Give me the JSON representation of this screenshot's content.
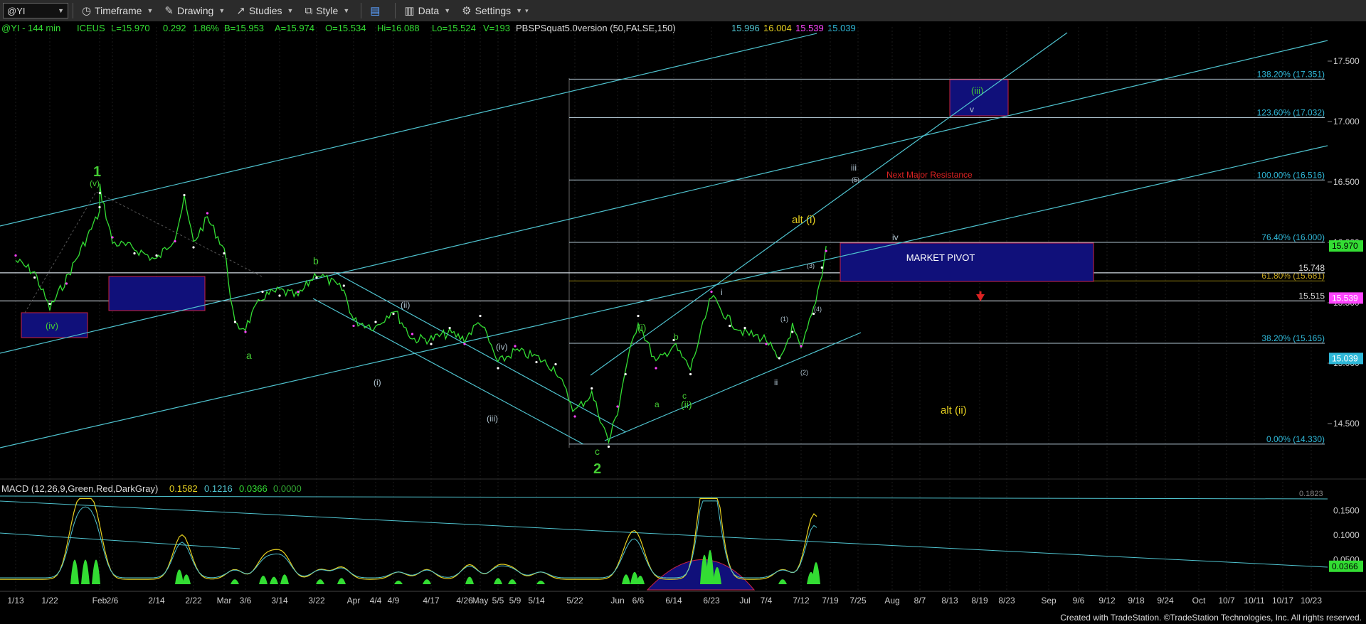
{
  "toolbar": {
    "symbol": "@YI",
    "timeframe": "Timeframe",
    "drawing": "Drawing",
    "studies": "Studies",
    "style": "Style",
    "data": "Data",
    "settings": "Settings"
  },
  "header": {
    "symbol_info": "@YI - 144 min",
    "exchange": "ICEUS",
    "last": "L=15.970",
    "change": "0.292",
    "pct": "1.86%",
    "bid": "B=15.953",
    "ask": "A=15.974",
    "open": "O=15.534",
    "high": "Hi=16.088",
    "low": "Lo=15.524",
    "volume": "V=193",
    "study_name": "PBSPSquat5.0version (50,FALSE,150)",
    "study_values": [
      "15.996",
      "16.004",
      "15.539",
      "15.039"
    ]
  },
  "macd_header": {
    "label": "MACD (12,26,9,Green,Red,DarkGray)",
    "values": [
      "0.1582",
      "0.1216",
      "0.0366",
      "0.0000"
    ]
  },
  "colors": {
    "bg": "#000000",
    "price": "#33dd33",
    "trendline": "#4fc3cf",
    "fib": "#b0c4d0",
    "box": "#10107a",
    "box_border": "#cc2244",
    "wave_green": "#44cc33",
    "wave_yellow": "#e6d020",
    "resistance_red": "#dd2222",
    "magenta": "#ff44ff"
  },
  "chart_data": {
    "type": "line",
    "title": "@YI - 144 min",
    "y_axis_labels": [
      "17.500",
      "17.000",
      "16.500",
      "16.000",
      "15.500",
      "15.000",
      "14.500"
    ],
    "ylim": [
      14.25,
      17.7
    ],
    "x_tick_labels": [
      "1/13",
      "1/22",
      "Feb",
      "2/6",
      "2/14",
      "2/22",
      "Mar",
      "3/6",
      "3/14",
      "3/22",
      "Apr",
      "4/4",
      "4/9",
      "4/17",
      "4/26",
      "May",
      "5/5",
      "5/9",
      "5/14",
      "5/22",
      "Jun",
      "6/6",
      "6/14",
      "6/23",
      "Jul",
      "7/4",
      "7/12",
      "7/19",
      "7/25",
      "Aug",
      "8/7",
      "8/13",
      "8/19",
      "8/23",
      "Sep",
      "9/6",
      "9/12",
      "9/18",
      "9/24",
      "Oct",
      "10/7",
      "10/11",
      "10/17",
      "10/23"
    ],
    "price_series": {
      "name": "@YI",
      "points": [
        [
          "1/13",
          15.85
        ],
        [
          "1/18",
          15.75
        ],
        [
          "1/22",
          15.45
        ],
        [
          "1/26",
          15.7
        ],
        [
          "Feb",
          16.25
        ],
        [
          "2/3",
          16.45
        ],
        [
          "2/6",
          16.0
        ],
        [
          "2/10",
          15.95
        ],
        [
          "2/14",
          15.85
        ],
        [
          "2/18",
          16.05
        ],
        [
          "2/20",
          16.35
        ],
        [
          "2/22",
          16.0
        ],
        [
          "2/26",
          16.2
        ],
        [
          "Mar",
          15.95
        ],
        [
          "3/3",
          15.3
        ],
        [
          "3/6",
          15.3
        ],
        [
          "3/10",
          15.55
        ],
        [
          "3/14",
          15.6
        ],
        [
          "3/18",
          15.55
        ],
        [
          "3/22",
          15.75
        ],
        [
          "3/28",
          15.6
        ],
        [
          "Apr",
          15.35
        ],
        [
          "4/4",
          15.3
        ],
        [
          "4/9",
          15.45
        ],
        [
          "4/13",
          15.2
        ],
        [
          "4/17",
          15.2
        ],
        [
          "4/22",
          15.25
        ],
        [
          "4/26",
          15.2
        ],
        [
          "May",
          15.35
        ],
        [
          "5/5",
          15.0
        ],
        [
          "5/9",
          15.1
        ],
        [
          "5/14",
          15.05
        ],
        [
          "5/18",
          14.95
        ],
        [
          "5/22",
          14.6
        ],
        [
          "5/26",
          14.75
        ],
        [
          "5/30",
          14.35
        ],
        [
          "Jun",
          14.6
        ],
        [
          "6/3",
          14.95
        ],
        [
          "6/6",
          15.35
        ],
        [
          "6/10",
          15.0
        ],
        [
          "6/14",
          15.15
        ],
        [
          "6/18",
          14.95
        ],
        [
          "6/23",
          15.55
        ],
        [
          "6/27",
          15.35
        ],
        [
          "Jul",
          15.25
        ],
        [
          "7/4",
          15.2
        ],
        [
          "7/7",
          15.0
        ],
        [
          "7/10",
          15.3
        ],
        [
          "7/12",
          15.1
        ],
        [
          "7/15",
          15.45
        ],
        [
          "7/17",
          15.75
        ],
        [
          "7/18",
          15.97
        ]
      ]
    },
    "fib_levels": [
      {
        "label": "138.20% (17.351)",
        "value": 17.351
      },
      {
        "label": "123.60% (17.032)",
        "value": 17.032
      },
      {
        "label": "100.00% (16.516)",
        "value": 16.516
      },
      {
        "label": "76.40% (16.000)",
        "value": 16.0
      },
      {
        "label": "61.80% (15.681)",
        "value": 15.681
      },
      {
        "label": "38.20% (15.165)",
        "value": 15.165
      },
      {
        "label": "0.00% (14.330)",
        "value": 14.33
      }
    ],
    "level_labels": [
      {
        "label": "15.748",
        "value": 15.748
      },
      {
        "label": "15.515",
        "value": 15.515
      }
    ],
    "price_badges": [
      {
        "label": "15.970",
        "value": 15.97,
        "color": "#33dd33"
      },
      {
        "label": "15.539",
        "value": 15.539,
        "color": "#ff44ff"
      },
      {
        "label": "15.039",
        "value": 15.039,
        "color": "#2fb8d8"
      }
    ],
    "annotations": {
      "market_pivot": "MARKET PIVOT",
      "next_resistance": "Next Major Resistance",
      "alt_i": "alt (i)",
      "alt_ii": "alt (ii)",
      "wave_1": "1",
      "wave_2": "2",
      "v_top": "(v)",
      "iv_box": "(iv)",
      "b_label": "b",
      "a_label": "a",
      "c_label": "c",
      "ii_paren": "(ii)",
      "i_paren": "(i)",
      "iv_paren": "(iv)",
      "iii_paren": "(iii)",
      "i_green": "(i)",
      "ii_green": "(ii)",
      "a_small": "a",
      "b_small": "b",
      "c_small": "c",
      "i_small": "i",
      "ii_small": "ii",
      "iii_small": "iii",
      "iv_small": "iv",
      "five_small": "(5)",
      "one_small": "(1)",
      "two_small": "(2)",
      "three_small": "(3)",
      "four_small": "(4)",
      "iii_target": "(iii)",
      "v_target": "v"
    },
    "macd": {
      "name": "MACD",
      "y_axis_labels": [
        "0.1500",
        "0.1000",
        "0.0500"
      ],
      "partial_label": "0.1823",
      "last_value": "0.0366",
      "ylim": [
        0,
        0.18
      ]
    }
  },
  "footer": "Created with TradeStation. ©TradeStation Technologies, Inc. All rights reserved."
}
